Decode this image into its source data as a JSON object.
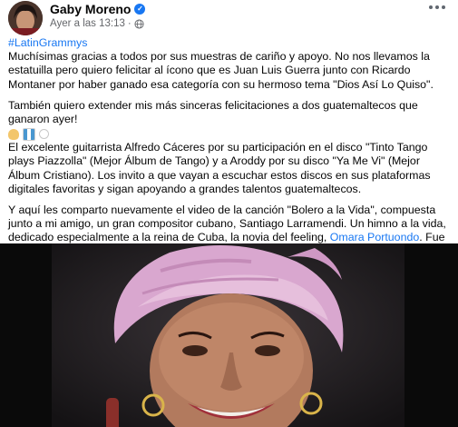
{
  "post": {
    "author": "Gaby Moreno",
    "timestamp": "Ayer a las 13:13",
    "privacy_icon": "globe-icon",
    "verified_icon": "verified-badge-icon",
    "hashtag": "#LatinGrammys",
    "paragraph1": "Muchísimas gracias a todos por sus muestras de cariño y apoyo. No nos llevamos la estatuilla pero quiero felicitar al ícono que es Juan Luis Guerra junto con Ricardo Montaner por haber ganado esa categoría con su hermoso tema \"Dios Así Lo Quiso\".",
    "paragraph2": "También quiero extender mis más sinceras felicitaciones a dos guatemaltecos que ganaron ayer!",
    "paragraph3": "El excelente guitarrista Alfredo Cáceres por su participación en el disco \"Tinto Tango plays Piazzolla\" (Mejor Álbum de Tango) y a Aroddy por su disco \"Ya Me Vi\" (Mejor Álbum Cristiano). Los invito a que vayan a escuchar estos discos en sus plataformas digitales favoritas y sigan apoyando a grandes talentos guatemaltecos.",
    "paragraph4_before": "Y aquí les comparto nuevamente el video de la canción \"Bolero a la Vida\", compuesta junto a mi amigo, un gran compositor cubano, Santiago Larramendi. Un himno a la vida, dedicado especialmente a la reina de Cuba, la novia del feeling, ",
    "paragraph4_mention": "Omara Portuondo",
    "paragraph4_after": ". Fue un sueño cantaria junto a ella y producir la canción también. Sigan compartiéndola y disfrutándola, que al final ese es el verdadero sueño de todo artista. Llegar a tantos oídos y corazones que podamos.",
    "emojis": [
      "clapping-hands-emoji",
      "guatemala-flag-emoji",
      "heart-emoji"
    ],
    "video_subject": "video-thumbnail"
  },
  "colors": {
    "link": "#1877f2",
    "secondary_text": "#65676b",
    "turban": "#d9a7cf",
    "skin": "#b27a5e"
  }
}
